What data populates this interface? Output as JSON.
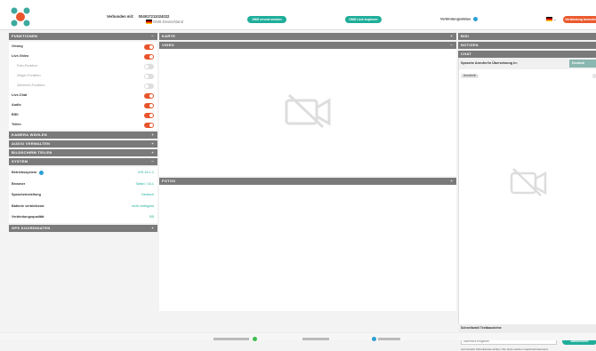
{
  "header": {
    "connected_label": "Verbunden mit:",
    "phone": "004917211024022",
    "country": "0049 Deutschland",
    "sms_send": "SMS erneut senden",
    "sms_copy": "SMS Link kopieren",
    "connection_status": "Verbindungsstatus",
    "end_call": "Verbindung beenden",
    "accent_teal": "#1fae9a",
    "accent_orange": "#ea5a2e"
  },
  "left": {
    "functions_title": "FUNKTIONEN",
    "functions": [
      {
        "label": "Ortung",
        "on": true
      },
      {
        "label": "Live-Video",
        "on": true
      },
      {
        "label": "Foto-Funktion",
        "on": false
      },
      {
        "label": "Zeiger-Funktion",
        "on": false
      },
      {
        "label": "Zeichnen-Funktion",
        "on": false
      },
      {
        "label": "Live-Chat",
        "on": true
      },
      {
        "label": "Audio",
        "on": true
      },
      {
        "label": "BIDI",
        "on": true
      },
      {
        "label": "Teilen",
        "on": true
      }
    ],
    "camera_title": "KAMERA WÄHLEN",
    "audio_title": "AUDIO VERWALTEN",
    "screen_title": "BILDSCHIRM TEILEN",
    "system_title": "SYSTEM",
    "system": [
      {
        "label": "Betriebssystem",
        "value": "iOS 16.1.1"
      },
      {
        "label": "Browser",
        "value": "Safari / 16.1"
      },
      {
        "label": "Spracheinstellung",
        "value": "Deutsch"
      },
      {
        "label": "Batterie verbleibend",
        "value": "nicht verfügbar"
      },
      {
        "label": "Verbindungsqualität",
        "value": "5/5"
      }
    ],
    "gps_title": "GPS KOORDINATEN"
  },
  "middle": {
    "map_title": "KARTE",
    "video_title": "VIDEO",
    "photos_title": "FOTOS"
  },
  "right": {
    "bidi_title": "BIDI",
    "notes_title": "NOTIZEN",
    "chat_title": "CHAT",
    "lang_label": "Sprache Anrufer/in Übersetzung in:",
    "lang_value": "Deutsch",
    "msg_label": "Anrufer/in",
    "quick_label": "Schnellwahl Textbausteine",
    "input_placeholder": "Nachricht eingeben",
    "send_label": "Abschicken",
    "hint": "Auf korrekte Schreibweise achten. Die Texte werden maschinell übersetzt."
  }
}
